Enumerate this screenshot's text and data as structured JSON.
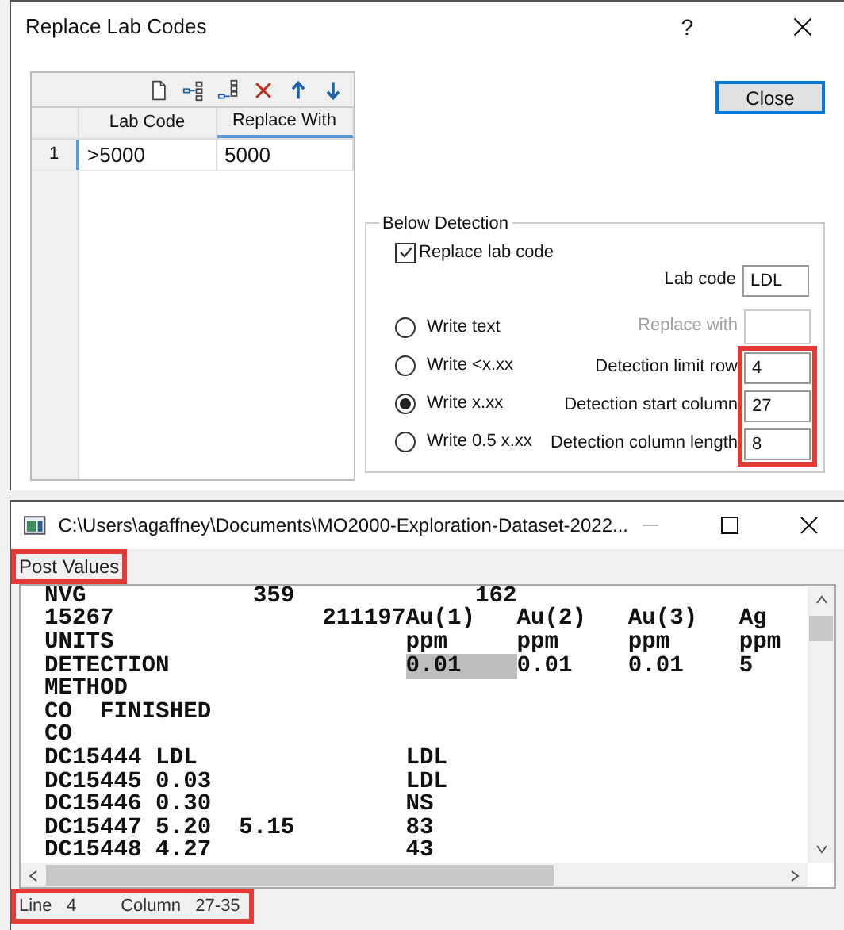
{
  "dialog": {
    "title": "Replace Lab Codes",
    "help": "?",
    "grid": {
      "columns": [
        "Lab Code",
        "Replace With"
      ],
      "rows": [
        {
          "number": "1",
          "cells": [
            ">5000",
            "5000"
          ]
        }
      ]
    },
    "close_button": "Close",
    "below_detection": {
      "title": "Below Detection",
      "replace_lab_code": {
        "label": "Replace lab code",
        "checked": true
      },
      "lab_code": {
        "label": "Lab code",
        "value": "LDL"
      },
      "options": [
        {
          "label": "Write text",
          "selected": false,
          "field_label": "Replace with",
          "disabled": true
        },
        {
          "label": "Write <x.xx",
          "selected": false,
          "field_label": "Detection limit row",
          "value": "4",
          "disabled": false
        },
        {
          "label": "Write x.xx",
          "selected": true,
          "field_label": "Detection start column",
          "value": "27",
          "disabled": false
        },
        {
          "label": "Write 0.5 x.xx",
          "selected": false,
          "field_label": "Detection column length",
          "value": "8",
          "disabled": false
        }
      ]
    }
  },
  "viewer": {
    "title": "C:\\Users\\agaffney\\Documents\\MO2000-Exploration-Dataset-2022...",
    "menu": [
      "Post Values"
    ],
    "lines": [
      [
        {
          "text": "NVG            359             162",
          "selected": false
        }
      ],
      [
        {
          "text": "15267               211197Au(1)   Au(2)   Au(3)   Ag",
          "selected": false
        }
      ],
      [
        {
          "text": "UNITS                     ppm     ppm     ppm     ppm",
          "selected": false
        }
      ],
      [
        {
          "text": "DETECTION                 ",
          "selected": false
        },
        {
          "text": "0.01    ",
          "selected": true
        },
        {
          "text": "0.01    0.01    5",
          "selected": false
        }
      ],
      [
        {
          "text": "METHOD",
          "selected": false
        }
      ],
      [
        {
          "text": "CO  FINISHED",
          "selected": false
        }
      ],
      [
        {
          "text": "CO",
          "selected": false
        }
      ],
      [
        {
          "text": "DC15444 LDL               LDL",
          "selected": false
        }
      ],
      [
        {
          "text": "DC15445 0.03              LDL",
          "selected": false
        }
      ],
      [
        {
          "text": "DC15446 0.30              NS",
          "selected": false
        }
      ],
      [
        {
          "text": "DC15447 5.20  5.15        83",
          "selected": false
        }
      ],
      [
        {
          "text": "DC15448 4.27              43",
          "selected": false
        }
      ]
    ],
    "status": [
      {
        "label": "Line",
        "value": "4"
      },
      {
        "label": "Column",
        "value": "27-35"
      }
    ]
  }
}
